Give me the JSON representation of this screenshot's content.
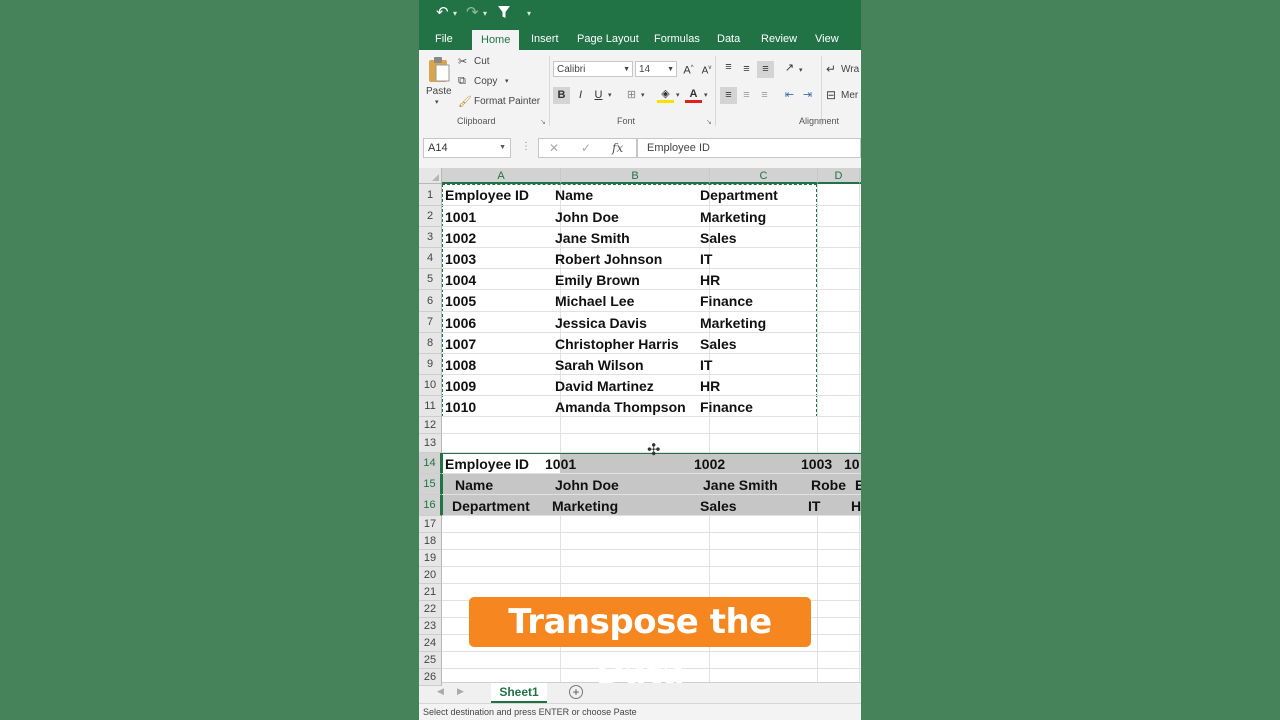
{
  "quick_access": {
    "undo_icon": "undo-icon",
    "redo_icon": "redo-icon",
    "filter_icon": "filter-icon",
    "more_icon": "customize-toolbar-icon"
  },
  "tabs": [
    {
      "label": "File"
    },
    {
      "label": "Home",
      "active": true
    },
    {
      "label": "Insert"
    },
    {
      "label": "Page Layout"
    },
    {
      "label": "Formulas"
    },
    {
      "label": "Data"
    },
    {
      "label": "Review"
    },
    {
      "label": "View"
    }
  ],
  "ribbon": {
    "clipboard": {
      "paste": "Paste",
      "cut": "Cut",
      "copy": "Copy",
      "format_painter": "Format Painter",
      "group_label": "Clipboard"
    },
    "font": {
      "font_name": "Calibri",
      "font_size": "14",
      "bold": "B",
      "italic": "I",
      "underline": "U",
      "grow": "A",
      "shrink": "A",
      "font_color": "A",
      "group_label": "Font"
    },
    "alignment": {
      "wrap": "Wra",
      "merge": "Mer",
      "group_label": "Alignment"
    }
  },
  "formula_bar": {
    "name_box": "A14",
    "formula": "Employee ID",
    "fx": "fx",
    "cancel": "✕",
    "enter": "✓"
  },
  "columns": [
    "A",
    "B",
    "C",
    "D"
  ],
  "rows": [
    "1",
    "2",
    "3",
    "4",
    "5",
    "6",
    "7",
    "8",
    "9",
    "10",
    "11",
    "12",
    "13",
    "14",
    "15",
    "16",
    "17",
    "18",
    "19",
    "20",
    "21",
    "22",
    "23",
    "24",
    "25",
    "26"
  ],
  "source_table": {
    "headers": [
      "Employee ID",
      "Name",
      "Department"
    ],
    "rows": [
      [
        "1001",
        "John Doe",
        "Marketing"
      ],
      [
        "1002",
        "Jane Smith",
        "Sales"
      ],
      [
        "1003",
        "Robert Johnson",
        "IT"
      ],
      [
        "1004",
        "Emily Brown",
        "HR"
      ],
      [
        "1005",
        "Michael Lee",
        "Finance"
      ],
      [
        "1006",
        "Jessica Davis",
        "Marketing"
      ],
      [
        "1007",
        "Christopher Harris",
        "Sales"
      ],
      [
        "1008",
        "Sarah Wilson",
        "IT"
      ],
      [
        "1009",
        "David Martinez",
        "HR"
      ],
      [
        "1010",
        "Amanda Thompson",
        "Finance"
      ]
    ]
  },
  "transposed": {
    "row14": [
      "Employee ID",
      "1001",
      "1002",
      "1003",
      "10"
    ],
    "row15": [
      "Name",
      "John Doe",
      "Jane Smith",
      "Robe",
      "E"
    ],
    "row16": [
      "Department",
      "Marketing",
      "Sales",
      "IT",
      "H"
    ]
  },
  "sheet_tab": "Sheet1",
  "status": "Select destination and press ENTER or choose Paste",
  "overlay_caption": "Transpose the Data",
  "colors": {
    "background": "#47835a",
    "excel_green": "#217346",
    "overlay": "#f58620"
  }
}
